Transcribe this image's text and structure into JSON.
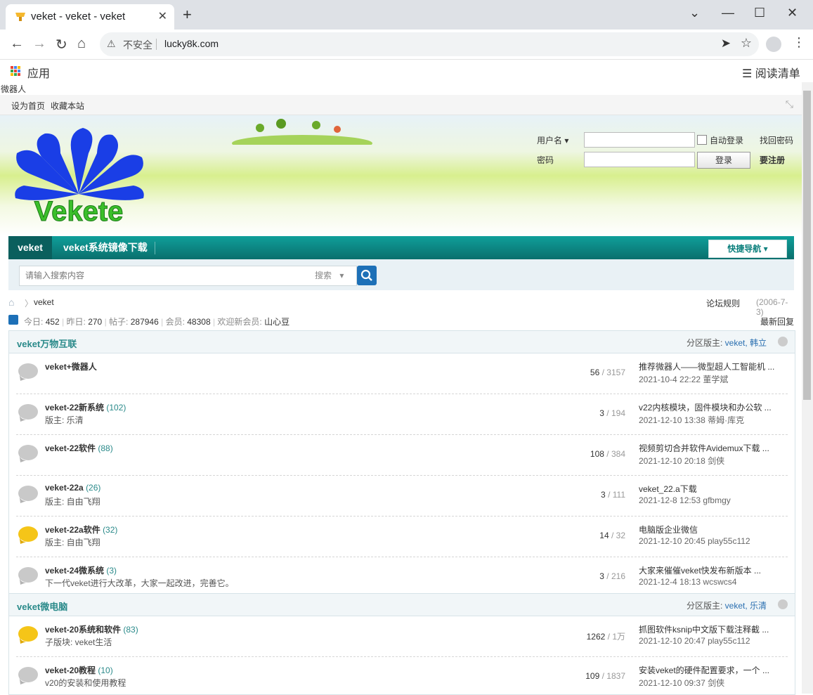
{
  "browser": {
    "tab_title": "veket - veket - veket",
    "insecure_label": "不安全",
    "url": "lucky8k.com",
    "apps_label": "应用",
    "reading_list_label": "阅读清单"
  },
  "page": {
    "title_line": "微器人",
    "topbar": {
      "set_home": "设为首页",
      "bookmark": "收藏本站"
    },
    "logo_text": "Vekete",
    "login": {
      "username_label": "用户名",
      "password_label": "密码",
      "auto_login": "自动登录",
      "find_password": "找回密码",
      "login_button": "登录",
      "register": "要注册"
    },
    "nav": {
      "active": "veket",
      "item2": "veket系统镜像下载",
      "quick_nav": "快捷导航"
    },
    "search": {
      "placeholder": "请输入搜索内容",
      "type": "搜索"
    },
    "breadcrumb": {
      "current": "veket",
      "rules": "论坛规则",
      "date": "(2006-7-3)"
    },
    "stats": {
      "today_label": "今日:",
      "today": "452",
      "yesterday_label": "昨日:",
      "yesterday": "270",
      "posts_label": "帖子:",
      "posts": "287946",
      "members_label": "会员:",
      "members": "48308",
      "welcome_label": "欢迎新会员:",
      "new_member": "山心豆",
      "latest_reply": "最新回复"
    },
    "categories": [
      {
        "title": "veket万物互联",
        "mods_label": "分区版主:",
        "mods": "veket, 韩立",
        "forums": [
          {
            "name": "veket+微器人",
            "count": "",
            "sub": "",
            "threads": "56",
            "total": "3157",
            "last_title": "推荐微器人——微型超人工智能机 ...",
            "last_meta": "2021-10-4 22:22 董学斌",
            "new": false
          },
          {
            "name": "veket-22新系统",
            "count": "(102)",
            "sub": "版主: 乐清",
            "threads": "3",
            "total": "194",
            "last_title": "v22内核模块，固件模块和办公软 ...",
            "last_meta": "2021-12-10 13:38 蒂姆·库克",
            "new": false
          },
          {
            "name": "veket-22软件",
            "count": "(88)",
            "sub": "",
            "threads": "108",
            "total": "384",
            "last_title": "视频剪切合并软件Avidemux下载 ...",
            "last_meta": "2021-12-10 20:18 剑侠",
            "new": false
          },
          {
            "name": "veket-22a",
            "count": "(26)",
            "sub": "版主: 自由飞翔",
            "threads": "3",
            "total": "111",
            "last_title": "veket_22.a下载",
            "last_meta": "2021-12-8 12:53 gfbmgy",
            "new": false
          },
          {
            "name": "veket-22a软件",
            "count": "(32)",
            "sub": "版主: 自由飞翔",
            "threads": "14",
            "total": "32",
            "last_title": "电脑版企业微信",
            "last_meta": "2021-12-10 20:45 play55c112",
            "new": true
          },
          {
            "name": "veket-24微系统",
            "count": "(3)",
            "sub": "下一代veket进行大改革，大家一起改进，完善它。",
            "threads": "3",
            "total": "216",
            "last_title": "大家来催催veket快发布新版本 ...",
            "last_meta": "2021-12-4 18:13 wcswcs4",
            "new": false
          }
        ]
      },
      {
        "title": "veket微电脑",
        "mods_label": "分区版主:",
        "mods": "veket, 乐清",
        "forums": [
          {
            "name": "veket-20系统和软件",
            "count": "(83)",
            "sub": "子版块: veket生活",
            "threads": "1262",
            "total": "1万",
            "last_title": "抓图软件ksnip中文版下载注释截 ...",
            "last_meta": "2021-12-10 20:47 play55c112",
            "new": true
          },
          {
            "name": "veket-20教程",
            "count": "(10)",
            "sub": "v20的安装和使用教程",
            "threads": "109",
            "total": "1837",
            "last_title": "安装veket的硬件配置要求，一个 ...",
            "last_meta": "2021-12-10 09:37 剑侠",
            "new": false
          }
        ]
      }
    ]
  }
}
